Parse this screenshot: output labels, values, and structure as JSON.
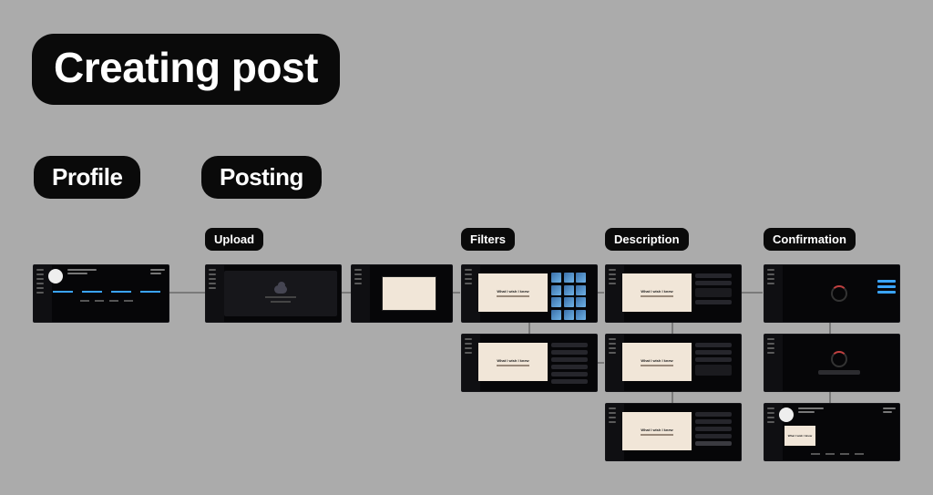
{
  "title": "Creating post",
  "sections": {
    "profile": "Profile",
    "posting": "Posting"
  },
  "steps": {
    "upload": "Upload",
    "filters": "Filters",
    "description": "Description",
    "confirmation": "Confirmation"
  },
  "mockCopy": {
    "bannerHeadline": "What I wish I knew",
    "bannerSub": "about figma &amp; UXUI"
  },
  "flow": {
    "columns": [
      {
        "id": "profile",
        "label": "Profile",
        "screens": 1
      },
      {
        "id": "upload",
        "label": "Upload",
        "screens": 2
      },
      {
        "id": "filters",
        "label": "Filters",
        "screens": 2
      },
      {
        "id": "description",
        "label": "Description",
        "screens": 3
      },
      {
        "id": "confirmation",
        "label": "Confirmation",
        "screens": 3
      }
    ],
    "edges": [
      [
        "profile.0",
        "upload.0"
      ],
      [
        "upload.0",
        "upload.1"
      ],
      [
        "upload.1",
        "filters.0"
      ],
      [
        "filters.0",
        "filters.1"
      ],
      [
        "filters.0",
        "description.0"
      ],
      [
        "description.0",
        "description.1"
      ],
      [
        "description.1",
        "description.2"
      ],
      [
        "description.0",
        "confirmation.0"
      ],
      [
        "confirmation.0",
        "confirmation.1"
      ],
      [
        "confirmation.1",
        "confirmation.2"
      ]
    ]
  }
}
